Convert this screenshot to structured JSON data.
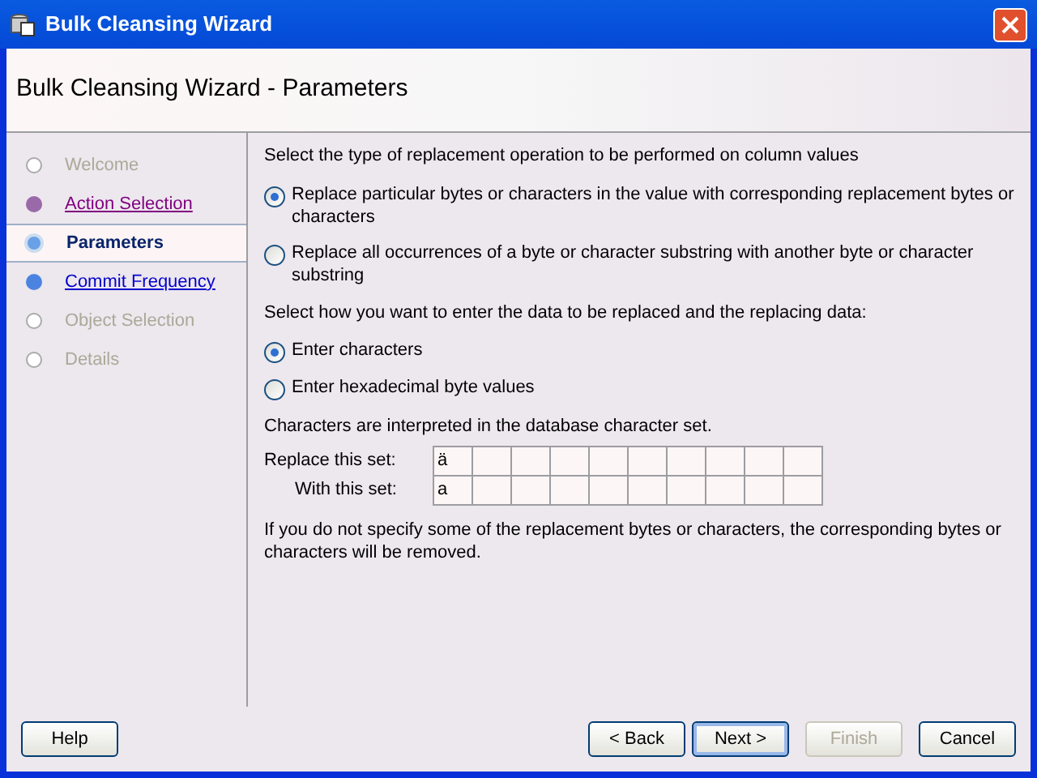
{
  "window": {
    "title": "Bulk Cleansing Wizard"
  },
  "header": {
    "title": "Bulk Cleansing Wizard - Parameters"
  },
  "steps": [
    {
      "label": "Welcome",
      "kind": "disabled",
      "selected": false
    },
    {
      "label": "Action Selection",
      "kind": "visited",
      "selected": false
    },
    {
      "label": "Parameters",
      "kind": "current",
      "selected": true
    },
    {
      "label": "Commit Frequency",
      "kind": "link",
      "selected": false
    },
    {
      "label": "Object Selection",
      "kind": "disabled",
      "selected": false
    },
    {
      "label": "Details",
      "kind": "disabled",
      "selected": false
    }
  ],
  "operation": {
    "prompt": "Select the type of replacement operation to be performed on column values",
    "options": [
      {
        "label": "Replace particular bytes or characters in the value with corresponding replacement bytes or characters",
        "selected": true
      },
      {
        "label": "Replace all occurrences of a byte or character substring with another byte or character substring",
        "selected": false
      }
    ]
  },
  "entry": {
    "prompt": "Select how you want to enter the data to be replaced and the replacing data:",
    "options": [
      {
        "label": "Enter characters",
        "selected": true
      },
      {
        "label": "Enter hexadecimal byte values",
        "selected": false
      }
    ]
  },
  "note": "Characters are interpreted in the database character set.",
  "sets": [
    {
      "label": "Replace this set:",
      "values": [
        "ä"
      ]
    },
    {
      "label": "With this set:",
      "values": [
        "a"
      ]
    }
  ],
  "footnote": "If you do not specify some of the replacement bytes or characters, the corresponding bytes or characters will be removed.",
  "buttons": [
    {
      "label": "Help",
      "disabled": false,
      "default": false
    },
    {
      "label": "< Back",
      "disabled": false,
      "default": false
    },
    {
      "label": "Next >",
      "disabled": false,
      "default": true
    },
    {
      "label": "Finish",
      "disabled": true,
      "default": false
    },
    {
      "label": "Cancel",
      "disabled": false,
      "default": false
    }
  ]
}
